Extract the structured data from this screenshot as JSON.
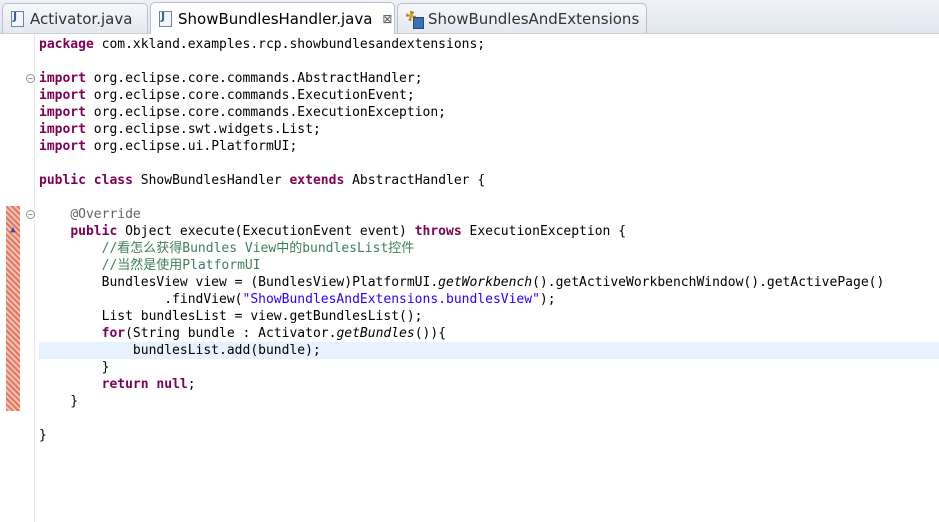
{
  "tabs": [
    {
      "label": "Activator.java",
      "icon": "java-file-icon",
      "active": false,
      "closable": false
    },
    {
      "label": "ShowBundlesHandler.java",
      "icon": "java-file-icon",
      "active": true,
      "closable": true,
      "close_glyph": "⊠"
    },
    {
      "label": "ShowBundlesAndExtensions",
      "icon": "plugin-manifest-icon",
      "active": false,
      "closable": false
    }
  ],
  "editor": {
    "colors": {
      "keyword": "#7f0055",
      "comment": "#3f7f5f",
      "string": "#2a00ff",
      "annotation": "#646464",
      "current_line": "#e8f2fe"
    },
    "fold_glyph": "⊖",
    "lines": [
      {
        "tokens": [
          {
            "t": "package",
            "c": "kw"
          },
          {
            "t": " com.xkland.examples.rcp.showbundlesandextensions;",
            "c": ""
          }
        ]
      },
      {
        "tokens": []
      },
      {
        "tokens": [
          {
            "t": "import",
            "c": "kw"
          },
          {
            "t": " org.eclipse.core.commands.AbstractHandler;",
            "c": ""
          }
        ],
        "fold": true
      },
      {
        "tokens": [
          {
            "t": "import",
            "c": "kw"
          },
          {
            "t": " org.eclipse.core.commands.ExecutionEvent;",
            "c": ""
          }
        ]
      },
      {
        "tokens": [
          {
            "t": "import",
            "c": "kw"
          },
          {
            "t": " org.eclipse.core.commands.ExecutionException;",
            "c": ""
          }
        ]
      },
      {
        "tokens": [
          {
            "t": "import",
            "c": "kw"
          },
          {
            "t": " org.eclipse.swt.widgets.List;",
            "c": ""
          }
        ]
      },
      {
        "tokens": [
          {
            "t": "import",
            "c": "kw"
          },
          {
            "t": " org.eclipse.ui.PlatformUI;",
            "c": ""
          }
        ]
      },
      {
        "tokens": []
      },
      {
        "tokens": [
          {
            "t": "public",
            "c": "kw"
          },
          {
            "t": " ",
            "c": ""
          },
          {
            "t": "class",
            "c": "kw"
          },
          {
            "t": " ShowBundlesHandler ",
            "c": ""
          },
          {
            "t": "extends",
            "c": "kw"
          },
          {
            "t": " AbstractHandler {",
            "c": ""
          }
        ]
      },
      {
        "tokens": []
      },
      {
        "tokens": [
          {
            "t": "    ",
            "c": ""
          },
          {
            "t": "@Override",
            "c": "an"
          }
        ],
        "fold": true
      },
      {
        "tokens": [
          {
            "t": "    ",
            "c": ""
          },
          {
            "t": "public",
            "c": "kw"
          },
          {
            "t": " Object execute(ExecutionEvent event) ",
            "c": ""
          },
          {
            "t": "throws",
            "c": "kw"
          },
          {
            "t": " ExecutionException {",
            "c": ""
          }
        ]
      },
      {
        "tokens": [
          {
            "t": "        ",
            "c": ""
          },
          {
            "t": "//看怎么获得Bundles View中的bundlesList控件",
            "c": "cm"
          }
        ]
      },
      {
        "tokens": [
          {
            "t": "        ",
            "c": ""
          },
          {
            "t": "//当然是使用PlatformUI",
            "c": "cm"
          }
        ]
      },
      {
        "tokens": [
          {
            "t": "        BundlesView view = (BundlesView)PlatformUI.",
            "c": ""
          },
          {
            "t": "getWorkbench",
            "c": "it"
          },
          {
            "t": "().getActiveWorkbenchWindow().getActivePage()",
            "c": ""
          }
        ]
      },
      {
        "tokens": [
          {
            "t": "                .findView(",
            "c": ""
          },
          {
            "t": "\"ShowBundlesAndExtensions.bundlesView\"",
            "c": "st"
          },
          {
            "t": ");",
            "c": ""
          }
        ]
      },
      {
        "tokens": [
          {
            "t": "        List bundlesList = view.getBundlesList();",
            "c": ""
          }
        ]
      },
      {
        "tokens": [
          {
            "t": "        ",
            "c": ""
          },
          {
            "t": "for",
            "c": "kw"
          },
          {
            "t": "(String bundle : Activator.",
            "c": ""
          },
          {
            "t": "getBundles",
            "c": "it"
          },
          {
            "t": "()){",
            "c": ""
          }
        ]
      },
      {
        "tokens": [
          {
            "t": "            bundlesList.add(bundle);",
            "c": ""
          }
        ],
        "current": true
      },
      {
        "tokens": [
          {
            "t": "        }",
            "c": ""
          }
        ]
      },
      {
        "tokens": [
          {
            "t": "        ",
            "c": ""
          },
          {
            "t": "return",
            "c": "kw"
          },
          {
            "t": " ",
            "c": ""
          },
          {
            "t": "null",
            "c": "kw"
          },
          {
            "t": ";",
            "c": ""
          }
        ]
      },
      {
        "tokens": [
          {
            "t": "    }",
            "c": ""
          }
        ]
      },
      {
        "tokens": []
      },
      {
        "tokens": [
          {
            "t": "}",
            "c": ""
          }
        ]
      }
    ]
  }
}
